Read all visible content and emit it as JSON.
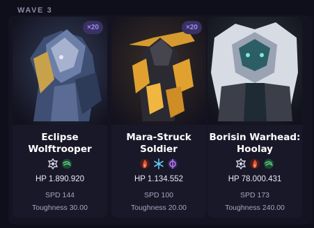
{
  "wave": {
    "label": "WAVE 3"
  },
  "enemies": [
    {
      "count": "×20",
      "name_line1": "Eclipse",
      "name_line2": "Wolftrooper",
      "weaknesses": [
        "quantum-icon",
        "wind-icon"
      ],
      "hp": "HP 1.890.920",
      "spd": "SPD 144",
      "toughness": "Toughness 30.00"
    },
    {
      "count": "×20",
      "name_line1": "Mara-Struck",
      "name_line2": "Soldier",
      "weaknesses": [
        "fire-icon",
        "ice-icon",
        "imaginary-icon"
      ],
      "hp": "HP 1.134.552",
      "spd": "SPD 100",
      "toughness": "Toughness 20.00"
    },
    {
      "count": "",
      "name_line1": "Borisin Warhead:",
      "name_line2": "Hoolay",
      "weaknesses": [
        "quantum-icon",
        "fire-icon",
        "wind-icon"
      ],
      "hp": "HP 78.000.431",
      "spd": "SPD 173",
      "toughness": "Toughness 240.00"
    }
  ],
  "colors": {
    "background": "#0f0e1b",
    "card": "#191828",
    "badge": "#3a3162",
    "fire": "#e2513b",
    "ice": "#5fc8f0",
    "wind": "#58c47c",
    "quantum": "#d9d7e8",
    "imaginary": "#b47cf0"
  }
}
